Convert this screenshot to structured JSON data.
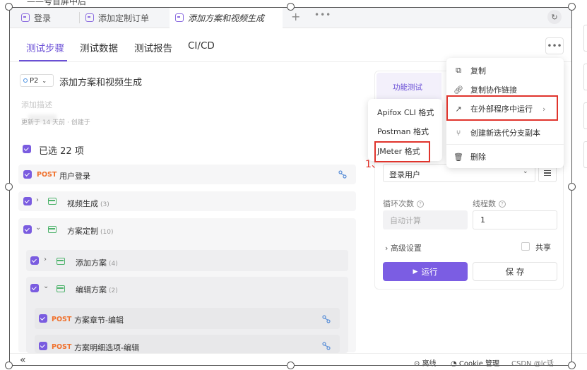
{
  "top_tabs": [
    {
      "label": "登录"
    },
    {
      "label": "添加定制订单"
    },
    {
      "label": "添加方案和视频生成"
    }
  ],
  "top_partial_text": "——号首屏中后",
  "section_tabs": [
    "测试步骤",
    "测试数据",
    "测试报告",
    "CI/CD"
  ],
  "case": {
    "priority": "P2",
    "title": "添加方案和视频生成",
    "description_placeholder": "添加描述",
    "meta": "更新于 14 天前 · 创建于 ",
    "selected_count": "已选 22 项"
  },
  "steps": [
    {
      "method": "POST",
      "name": "用户登录"
    },
    {
      "name": "视频生成",
      "count": "(3)"
    },
    {
      "name": "方案定制",
      "count": "(10)"
    },
    {
      "name": "添加方案",
      "count": "(4)"
    },
    {
      "name": "编辑方案",
      "count": "(2)"
    },
    {
      "method": "POST",
      "name": "方案章节-编辑"
    },
    {
      "method": "POST",
      "name": "方案明细选项-编辑"
    }
  ],
  "right_panel": {
    "tab": "功能测试",
    "env_value": "登录用户",
    "loop_label": "循环次数",
    "loop_value": "自动计算",
    "threads_label": "线程数",
    "threads_value": "1",
    "advanced": "高级设置",
    "share": "共享",
    "run": "运行",
    "save": "保 存"
  },
  "more_menu": [
    {
      "label": "复制",
      "icon": "copy-icon"
    },
    {
      "label": "复制协作链接",
      "icon": "link-icon"
    },
    {
      "label": "在外部程序中运行",
      "icon": "external-run-icon"
    },
    {
      "label": "创建新迭代分支副本",
      "icon": "branch-icon"
    },
    {
      "label": "删除",
      "icon": "trash-icon"
    }
  ],
  "sub_menu": [
    "Apifox CLI 格式",
    "Postman 格式",
    "JMeter 格式"
  ],
  "annotation": "1、",
  "status_bar": {
    "offline": "离线",
    "cookie": "Cookie 管理",
    "watermark": "CSDN @lc话"
  },
  "colors": {
    "accent": "#6a4fd6",
    "run_button": "#7b5de3",
    "method_post": "#f0702b",
    "folder": "#4db36b",
    "highlight": "#e0342c"
  }
}
